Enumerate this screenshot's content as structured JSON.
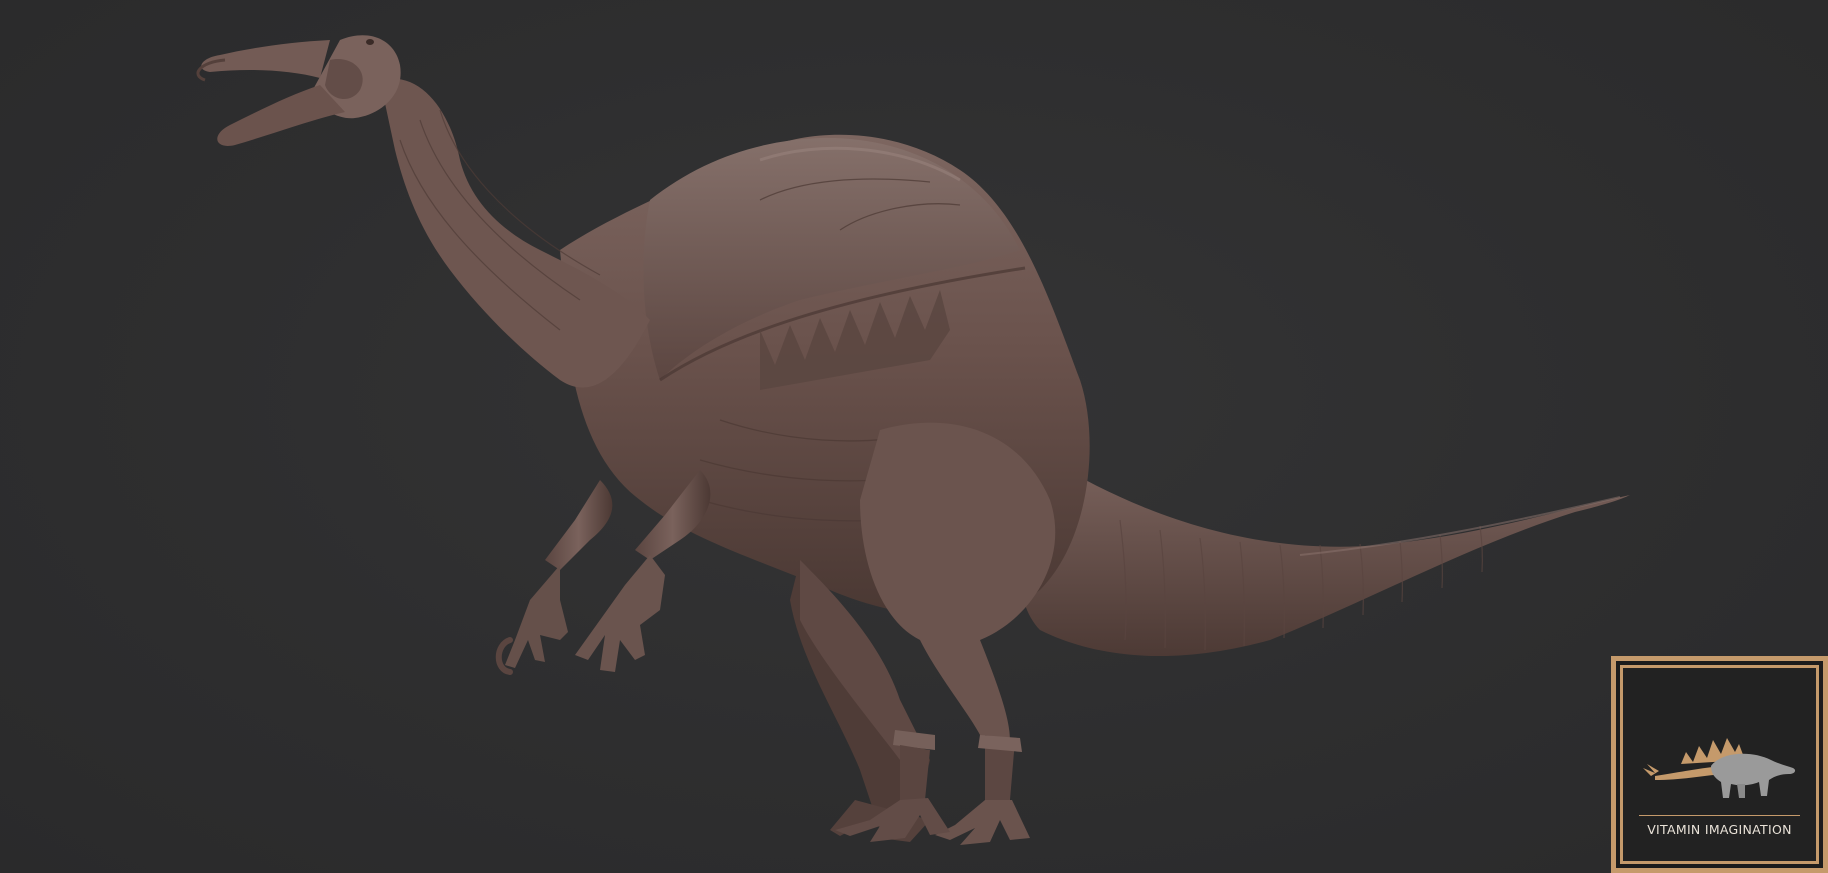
{
  "scene": {
    "subject": "dinosaur-sculpt",
    "background_color": "#2e2e2f",
    "sculpt_color": "#6e5650"
  },
  "watermark": {
    "text": "VITAMIN IMAGINATION",
    "frame_color": "#c59a6b",
    "icon": "stegosaurus-icon"
  }
}
